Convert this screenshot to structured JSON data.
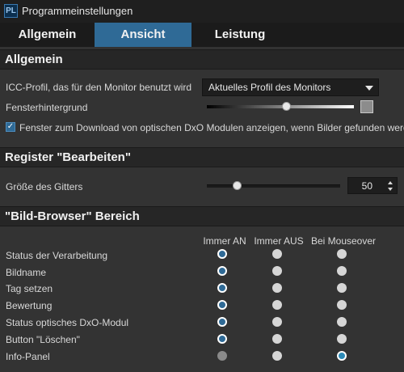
{
  "window": {
    "title": "Programmeinstellungen",
    "app_icon": "PL"
  },
  "tabs": [
    {
      "label": "Allgemein"
    },
    {
      "label": "Ansicht",
      "active": true
    },
    {
      "label": "Leistung"
    }
  ],
  "general": {
    "header": "Allgemein",
    "icc_label": "ICC-Profil, das für den Monitor benutzt wird",
    "icc_value": "Aktuelles Profil des Monitors",
    "background_label": "Fensterhintergrund",
    "background_level_percent": 55,
    "background_color": "#8c8c8c",
    "download_checked": true,
    "download_label": "Fenster zum Download  von optischen DxO Modulen anzeigen, wenn Bilder gefunden werd"
  },
  "edit": {
    "header": "Register \"Bearbeiten\"",
    "grid_label": "Größe des Gitters",
    "grid_value": "50"
  },
  "browser": {
    "header": "\"Bild-Browser\" Bereich",
    "columns": [
      "Immer AN",
      "Immer AUS",
      "Bei Mouseover"
    ],
    "rows": [
      {
        "label": "Status der Verarbeitung",
        "selected": "Immer AN"
      },
      {
        "label": "Bildname",
        "selected": "Immer AN"
      },
      {
        "label": "Tag setzen",
        "selected": "Immer AN"
      },
      {
        "label": "Bewertung",
        "selected": "Immer AN"
      },
      {
        "label": "Status optisches DxO-Modul",
        "selected": "Immer AN"
      },
      {
        "label": "Button \"Löschen\"",
        "selected": "Immer AN"
      },
      {
        "label": "Info-Panel",
        "selected": "Bei Mouseover",
        "disabled_option": "Immer AN"
      }
    ]
  },
  "colors": {
    "accent": "#2f6a96",
    "background": "#333333",
    "header_bg": "#262626"
  }
}
